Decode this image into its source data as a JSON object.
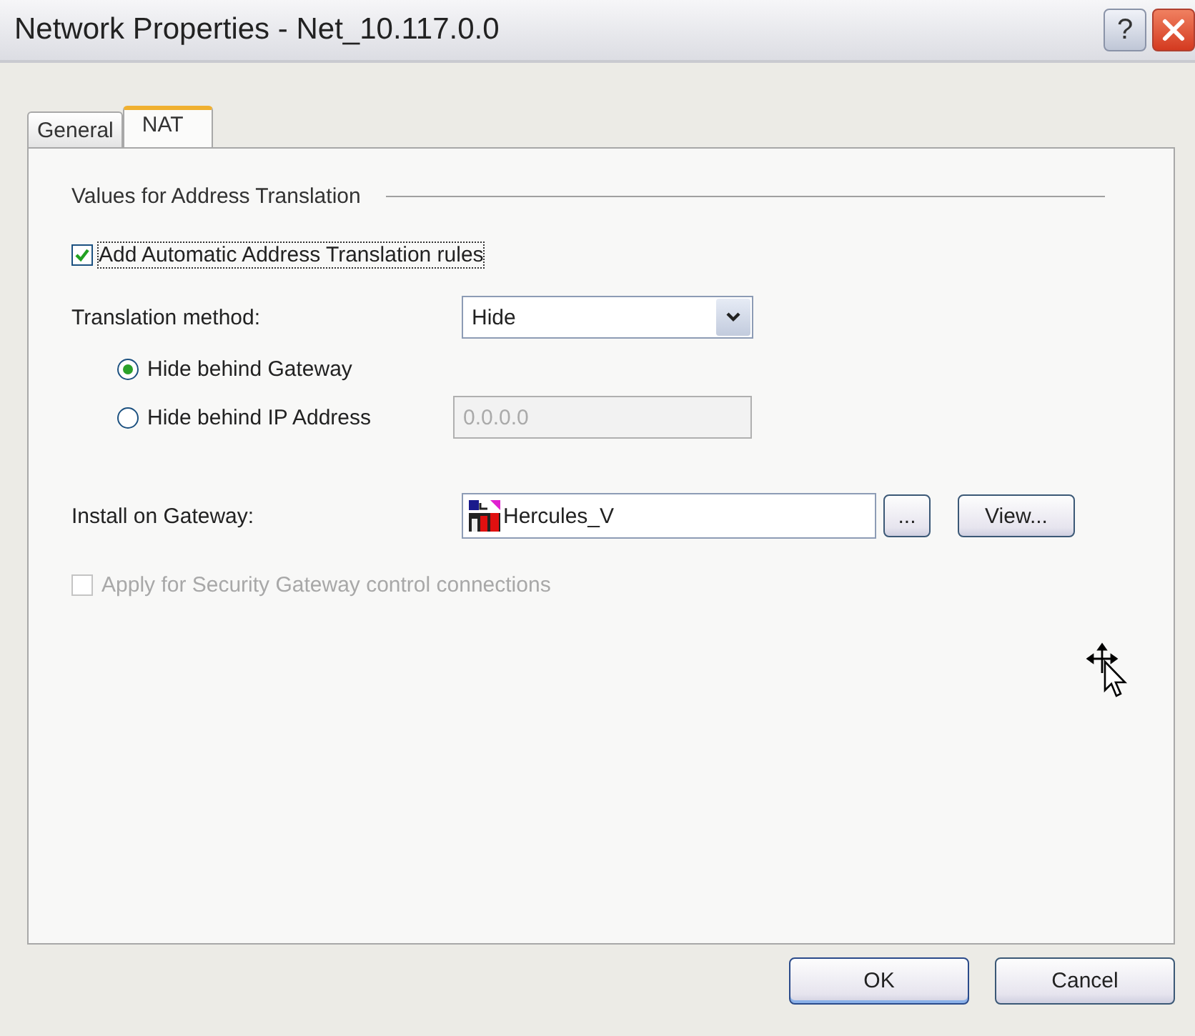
{
  "window": {
    "title": "Network Properties - Net_10.117.0.0",
    "help": "?"
  },
  "tabs": [
    {
      "label": "General",
      "selected": false
    },
    {
      "label": "NAT",
      "selected": true
    }
  ],
  "group": {
    "title": "Values for Address Translation"
  },
  "auto_rules": {
    "label": "Add Automatic Address Translation rules",
    "checked": true,
    "focused": true
  },
  "translation_method": {
    "label": "Translation method:",
    "value": "Hide"
  },
  "radios": [
    {
      "label": "Hide behind Gateway",
      "selected": true
    },
    {
      "label": "Hide behind IP Address",
      "selected": false,
      "field": {
        "value": "0.0.0.0",
        "disabled": true
      }
    }
  ],
  "install": {
    "label": "Install on Gateway:",
    "value": "Hercules_V",
    "browse": "...",
    "view": "View..."
  },
  "control_connections": {
    "label": "Apply for Security Gateway control connections",
    "checked": false,
    "disabled": true
  },
  "buttons": [
    "OK",
    "Cancel"
  ]
}
